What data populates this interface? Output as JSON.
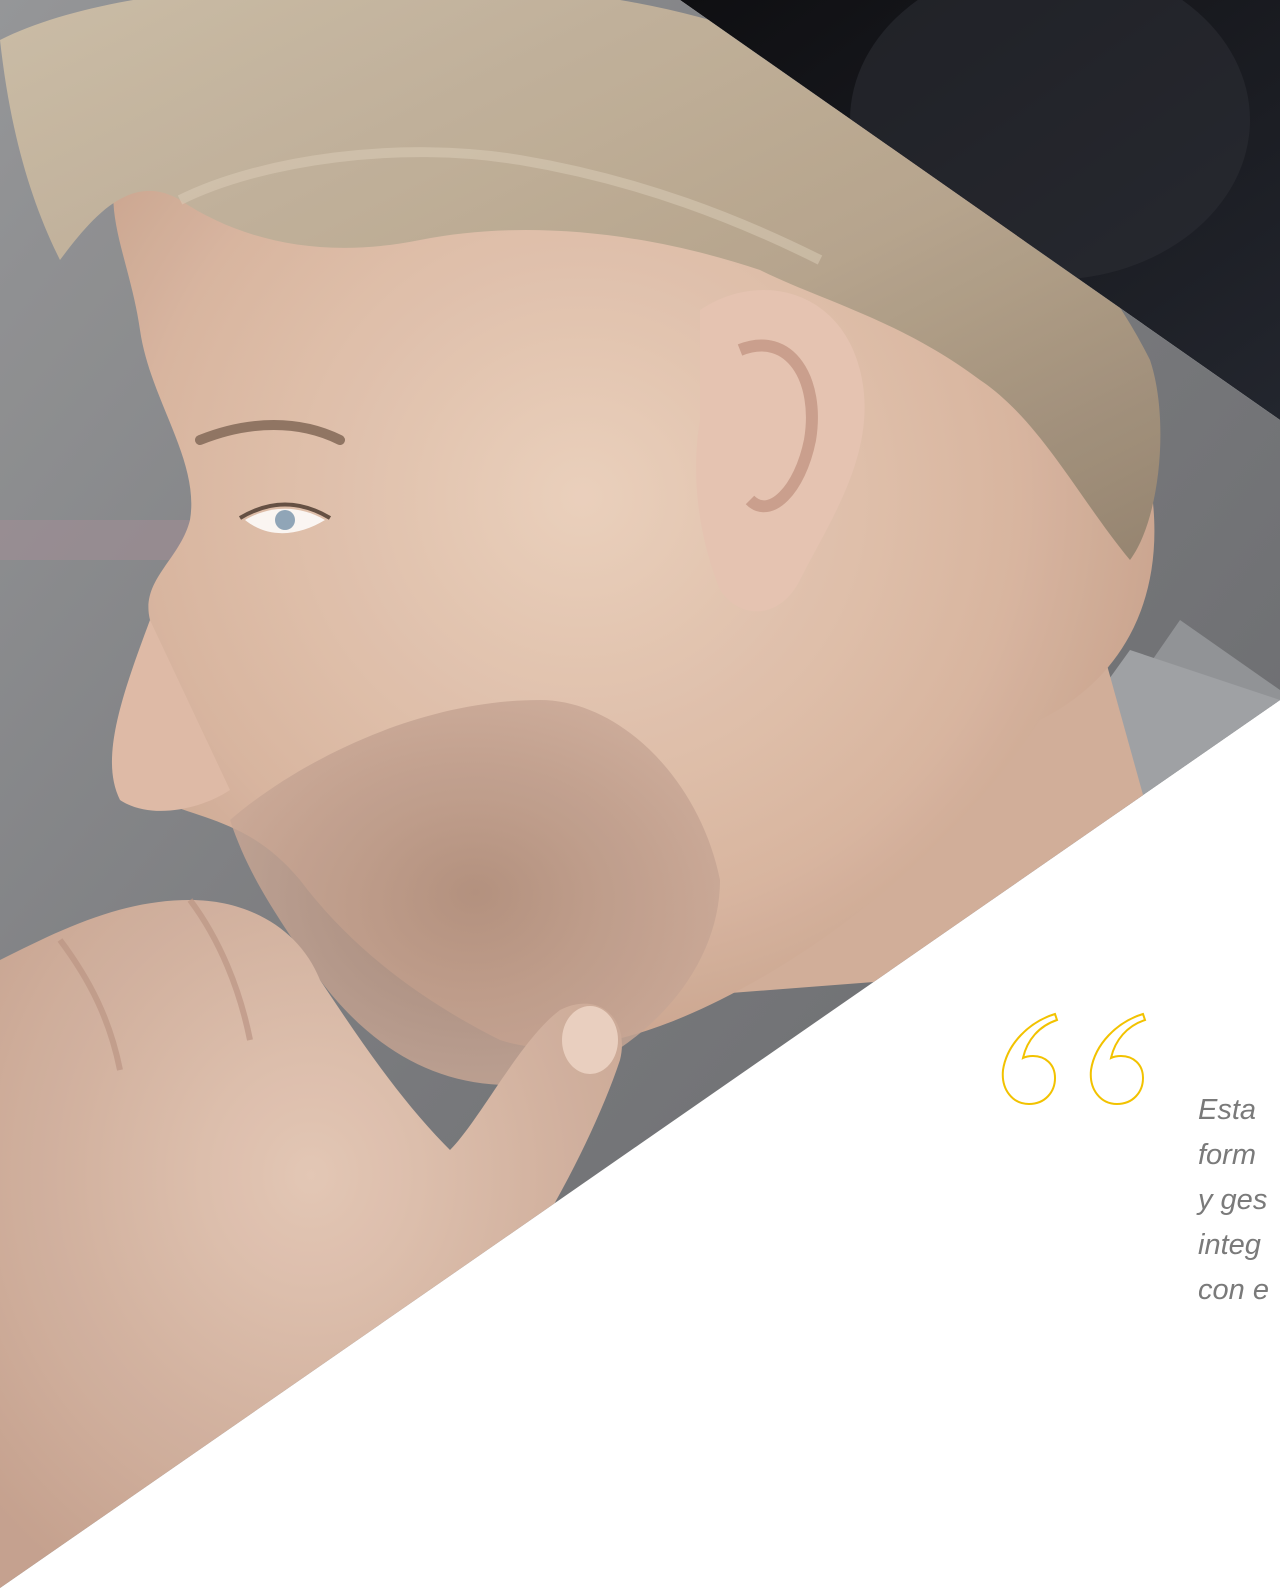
{
  "hero": {
    "image_subject": "man-in-profile-thinking",
    "colors": {
      "background": "#ffffff",
      "quote_mark": "#f2c200",
      "quote_text": "#7a7a7a",
      "dark_backdrop": "#15161a"
    }
  },
  "quote": {
    "icon": "quotation-mark-icon",
    "lines": [
      "Esta",
      "form",
      "y ges",
      "integ",
      "con e"
    ]
  }
}
